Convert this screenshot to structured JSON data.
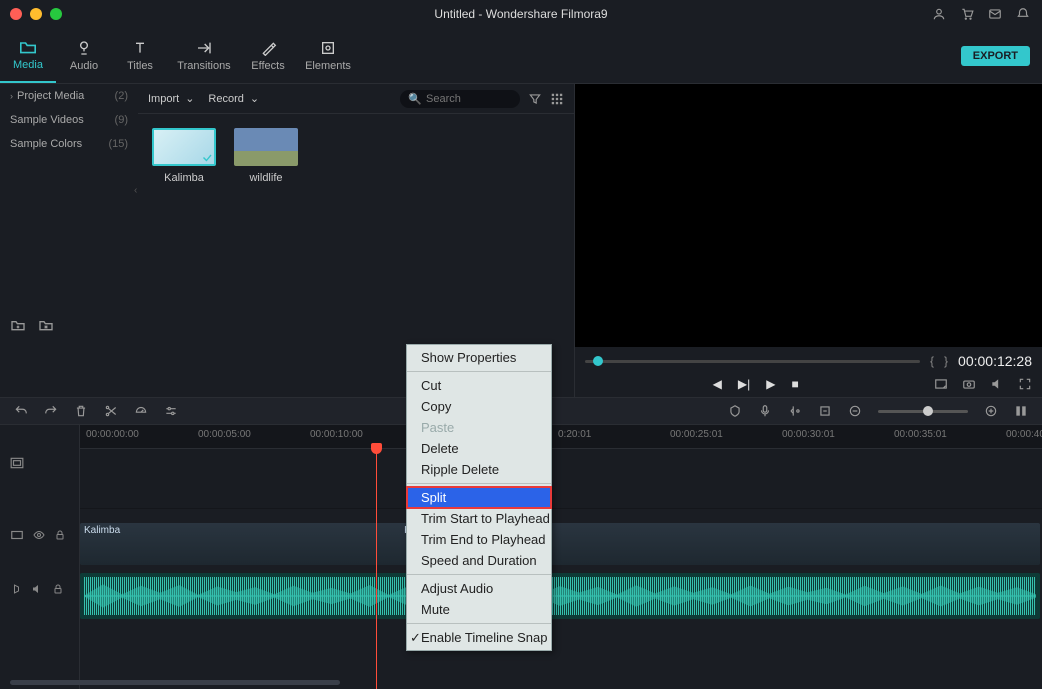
{
  "titlebar": {
    "title": "Untitled - Wondershare Filmora9"
  },
  "tabs": [
    {
      "label": "Media",
      "icon": "folder-icon",
      "active": true
    },
    {
      "label": "Audio",
      "icon": "audio-icon"
    },
    {
      "label": "Titles",
      "icon": "titles-icon"
    },
    {
      "label": "Transitions",
      "icon": "transitions-icon"
    },
    {
      "label": "Effects",
      "icon": "effects-icon"
    },
    {
      "label": "Elements",
      "icon": "elements-icon"
    }
  ],
  "export_label": "EXPORT",
  "sidebar": {
    "items": [
      {
        "label": "Project Media",
        "count": "(2)",
        "expandable": true
      },
      {
        "label": "Sample Videos",
        "count": "(9)"
      },
      {
        "label": "Sample Colors",
        "count": "(15)"
      }
    ]
  },
  "importbar": {
    "import": "Import",
    "record": "Record",
    "search_placeholder": "Search"
  },
  "media": [
    {
      "label": "Kalimba"
    },
    {
      "label": "wildlife"
    }
  ],
  "preview": {
    "timecode": "00:00:12:28"
  },
  "ruler": [
    "00:00:00:00",
    "00:00:05:00",
    "00:00:10:00",
    "0:20:01",
    "00:00:25:01",
    "00:00:30:01",
    "00:00:35:01",
    "00:00:40:01"
  ],
  "ruler_positions": [
    6,
    118,
    230,
    478,
    590,
    702,
    814,
    926
  ],
  "clip_labels": {
    "video": "Kalimba",
    "video_right": "Kalimba"
  },
  "context_menu": {
    "items": [
      {
        "label": "Show Properties"
      },
      {
        "sep": true
      },
      {
        "label": "Cut"
      },
      {
        "label": "Copy"
      },
      {
        "label": "Paste",
        "disabled": true
      },
      {
        "label": "Delete"
      },
      {
        "label": "Ripple Delete"
      },
      {
        "sep": true
      },
      {
        "label": "Split",
        "selected": true
      },
      {
        "label": "Trim Start to Playhead"
      },
      {
        "label": "Trim End to Playhead"
      },
      {
        "label": "Speed and Duration"
      },
      {
        "sep": true
      },
      {
        "label": "Adjust Audio"
      },
      {
        "label": "Mute"
      },
      {
        "sep": true
      },
      {
        "label": "Enable Timeline Snap",
        "checked": true
      }
    ]
  }
}
